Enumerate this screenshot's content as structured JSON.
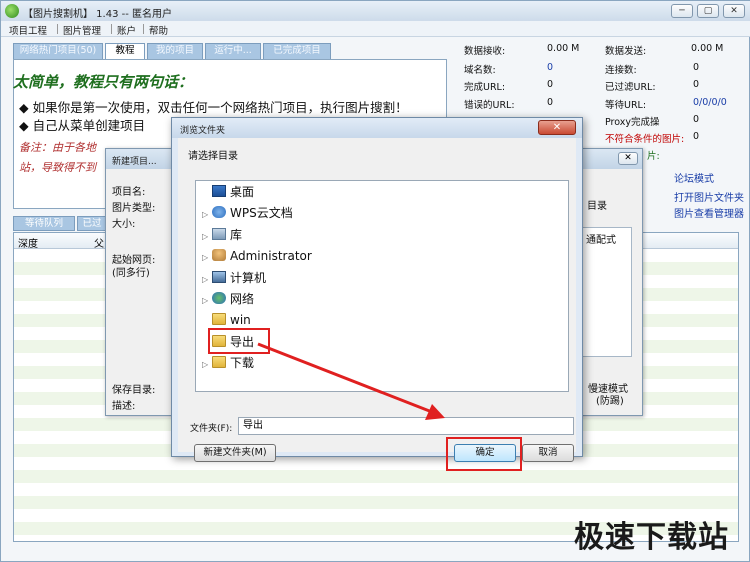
{
  "window": {
    "title": "【图片搜割机】 1.43 -- 匿名用户",
    "min": "─",
    "max": "▢",
    "close": "✕"
  },
  "menu": [
    "项目工程",
    "图片管理",
    "账户",
    "帮助"
  ],
  "tabs": [
    "网络热门项目(50)",
    "教程",
    "我的项目",
    "运行中...",
    "已完成项目"
  ],
  "tutorial": {
    "headline": "太简单，教程只有两句话：",
    "line1": "◆ 如果你是第一次使用，双击任何一个网络热门项目，执行图片搜割！",
    "line2": "◆ 自己从菜单创建项目",
    "note1": "备注：由于各地",
    "note2": "站，导致得不到"
  },
  "stats": {
    "left": [
      {
        "label": "数据接收:",
        "value": "0.00 M"
      },
      {
        "label": "域名数:",
        "value": "0"
      },
      {
        "label": "完成URL:",
        "value": "0"
      },
      {
        "label": "错误的URL:",
        "value": "0"
      }
    ],
    "right": [
      {
        "label": "数据发送:",
        "value": "0.00 M"
      },
      {
        "label": "连接数:",
        "value": "0"
      },
      {
        "label": "已过滤URL:",
        "value": "0"
      },
      {
        "label": "等待URL:",
        "value": "0/0/0/0"
      },
      {
        "label": "Proxy完成操",
        "value": "0"
      },
      {
        "label": "不符合条件的图片:",
        "value": "0"
      }
    ],
    "partial": "片:"
  },
  "side_links": [
    "论坛模式",
    "打开图片文件夹",
    "图片查看管理器"
  ],
  "queue_tabs": [
    "等待队列",
    "已过"
  ],
  "list_headers": [
    "深度",
    "父"
  ],
  "new_project": {
    "title": "新建项目...",
    "close": "✕",
    "labels": [
      "项目名:",
      "图片类型:",
      "大小:",
      "起始网页:",
      "(同多行)",
      "保存目录:",
      "描述:"
    ],
    "right_labels": [
      "目录",
      "通配式",
      "慢速模式",
      "(防踢)"
    ]
  },
  "browse": {
    "title": "浏览文件夹",
    "close": "✕",
    "prompt": "请选择目录",
    "tree": [
      {
        "label": "桌面",
        "icon": "desktop-icon",
        "expander": ""
      },
      {
        "label": "WPS云文档",
        "icon": "cloud-icon",
        "expander": "▷"
      },
      {
        "label": "库",
        "icon": "library-icon",
        "expander": "▷"
      },
      {
        "label": "Administrator",
        "icon": "user-folder-icon",
        "expander": "▷"
      },
      {
        "label": "计算机",
        "icon": "computer-icon",
        "expander": "▷"
      },
      {
        "label": "网络",
        "icon": "network-icon",
        "expander": "▷"
      },
      {
        "label": "win",
        "icon": "folder-icon",
        "expander": ""
      },
      {
        "label": "导出",
        "icon": "folder-icon",
        "expander": ""
      },
      {
        "label": "下载",
        "icon": "folder-icon",
        "expander": "▷"
      }
    ],
    "selected": "导出",
    "folder_label": "文件夹(F):",
    "folder_value": "导出",
    "new_folder": "新建文件夹(M)",
    "ok": "确定",
    "cancel": "取消"
  },
  "colors": {
    "highlight": "#e02020",
    "arrow": "#e02020"
  },
  "watermark": "极速下载站"
}
